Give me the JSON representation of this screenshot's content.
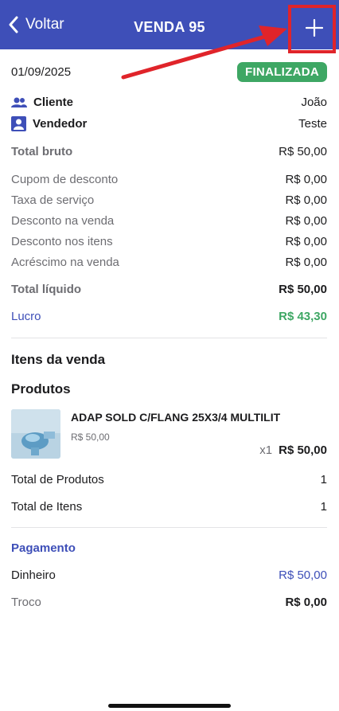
{
  "header": {
    "back_label": "Voltar",
    "title": "VENDA 95",
    "add_icon": "plus-icon"
  },
  "summary": {
    "date": "01/09/2025",
    "status": "FINALIZADA",
    "client_label": "Cliente",
    "client_value": "João",
    "seller_label": "Vendedor",
    "seller_value": "Teste",
    "gross_label": "Total bruto",
    "gross_value": "R$ 50,00",
    "lines": [
      {
        "label": "Cupom de desconto",
        "value": "R$ 0,00"
      },
      {
        "label": "Taxa de serviço",
        "value": "R$ 0,00"
      },
      {
        "label": "Desconto na venda",
        "value": "R$ 0,00"
      },
      {
        "label": "Desconto nos itens",
        "value": "R$ 0,00"
      },
      {
        "label": "Acréscimo na venda",
        "value": "R$ 0,00"
      }
    ],
    "net_label": "Total líquido",
    "net_value": "R$ 50,00",
    "profit_label": "Lucro",
    "profit_value": "R$ 43,30"
  },
  "items": {
    "section_title": "Itens da venda",
    "products_title": "Produtos",
    "product": {
      "name": "ADAP SOLD C/FLANG 25X3/4 MULTILIT",
      "unit_price": "R$ 50,00",
      "qty": "x1",
      "total": "R$ 50,00"
    },
    "total_products_label": "Total de Produtos",
    "total_products_value": "1",
    "total_items_label": "Total de Itens",
    "total_items_value": "1"
  },
  "payment": {
    "title": "Pagamento",
    "method_label": "Dinheiro",
    "method_value": "R$ 50,00",
    "change_label": "Troco",
    "change_value": "R$ 0,00"
  },
  "colors": {
    "header_bg": "#3e4fb8",
    "status_green": "#3ea764",
    "annotation_red": "#e0242a"
  }
}
